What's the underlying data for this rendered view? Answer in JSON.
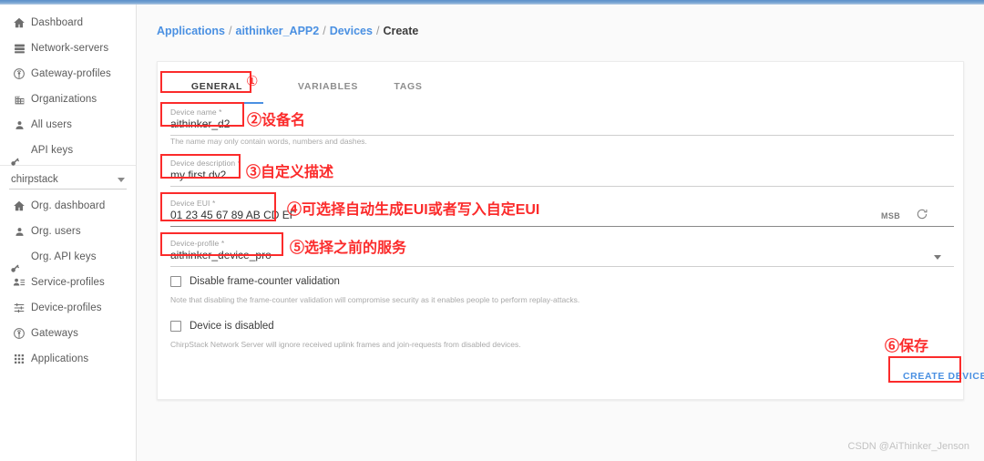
{
  "app": {
    "watermark": "CSDN @AiThinker_Jenson"
  },
  "sidebar": {
    "global_items": [
      {
        "label": "Dashboard",
        "icon": "home-icon"
      },
      {
        "label": "Network-servers",
        "icon": "server-icon"
      },
      {
        "label": "Gateway-profiles",
        "icon": "antenna-icon"
      },
      {
        "label": "Organizations",
        "icon": "building-icon"
      },
      {
        "label": "All users",
        "icon": "person-icon"
      },
      {
        "label": "API keys",
        "icon": "key-icon"
      }
    ],
    "org_selector": {
      "value": "chirpstack",
      "icon": "chevron-down-icon"
    },
    "org_items": [
      {
        "label": "Org. dashboard",
        "icon": "home-icon"
      },
      {
        "label": "Org. users",
        "icon": "person-icon"
      },
      {
        "label": "Org. API keys",
        "icon": "key-icon"
      },
      {
        "label": "Service-profiles",
        "icon": "person-list-icon"
      },
      {
        "label": "Device-profiles",
        "icon": "sliders-icon"
      },
      {
        "label": "Gateways",
        "icon": "antenna-icon"
      },
      {
        "label": "Applications",
        "icon": "grid-icon"
      }
    ]
  },
  "breadcrumb": {
    "items": [
      {
        "label": "Applications",
        "link": true
      },
      {
        "label": "aithinker_APP2",
        "link": true
      },
      {
        "label": "Devices",
        "link": true
      },
      {
        "label": "Create",
        "link": false
      }
    ],
    "separator": "/"
  },
  "tabs": [
    {
      "label": "GENERAL",
      "active": true
    },
    {
      "label": "VARIABLES",
      "active": false
    },
    {
      "label": "TAGS",
      "active": false
    }
  ],
  "form": {
    "device_name": {
      "label": "Device name *",
      "value": "aithinker_d2",
      "help": "The name may only contain words, numbers and dashes."
    },
    "device_description": {
      "label": "Device description *",
      "value": "my first dv2"
    },
    "device_eui": {
      "label": "Device EUI *",
      "value": "01 23 45 67 89 AB CD EF",
      "endianness": "MSB",
      "refresh_icon": "refresh-icon"
    },
    "device_profile": {
      "label": "Device-profile *",
      "value": "aithinker_device_pro",
      "caret_icon": "chevron-down-icon"
    },
    "disable_frame_counter": {
      "label": "Disable frame-counter validation",
      "checked": false,
      "help": "Note that disabling the frame-counter validation will compromise security as it enables people to perform replay-attacks."
    },
    "device_disabled": {
      "label": "Device is disabled",
      "checked": false,
      "help": "ChirpStack Network Server will ignore received uplink frames and join-requests from disabled devices."
    },
    "submit_label": "CREATE DEVICE"
  },
  "annotations": [
    {
      "marker": "①",
      "text": ""
    },
    {
      "marker": "②",
      "text": "设备名"
    },
    {
      "marker": "③",
      "text": "自定义描述"
    },
    {
      "marker": "④",
      "text": "可选择自动生成EUI或者写入自定EUI"
    },
    {
      "marker": "⑤",
      "text": "选择之前的服务"
    },
    {
      "marker": "⑥",
      "text": "保存"
    }
  ]
}
